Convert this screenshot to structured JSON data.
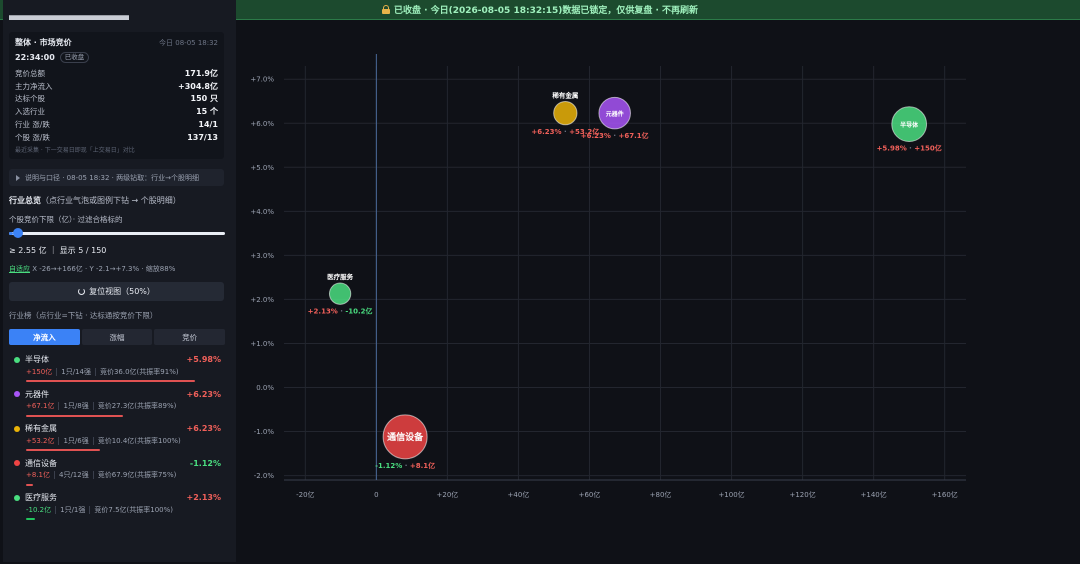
{
  "banner": {
    "text": "已收盘 · 今日(2026-08-05 18:32:15)数据已锁定，仅供复盘 · 不再刷新",
    "icon": "lock-icon",
    "color": "#9ff0bd"
  },
  "summary": {
    "title": "整体 · 市场竞价",
    "date": "今日 08-05 18:32",
    "time": "22:34:00",
    "badge": "已收盘",
    "rows": [
      {
        "label": "竞价总额",
        "value": "171.9亿"
      },
      {
        "label": "主力净流入",
        "value": "+304.8亿"
      },
      {
        "label": "达标个股",
        "value": "150 只"
      },
      {
        "label": "入选行业",
        "value": "15 个"
      },
      {
        "label": "行业 涨/跌",
        "value": "14/1"
      },
      {
        "label": "个股 涨/跌",
        "value": "137/13"
      }
    ],
    "note": "最近采集 · 下一交易日即现「上交易日」对比"
  },
  "collapse": {
    "text": "说明与口径 · 08-05 18:32 · 两级钻取：行业→个股明细"
  },
  "section": {
    "title": "行业总览",
    "hint": "（点行业气泡或图例下钻 → 个股明细）"
  },
  "filter": {
    "label": "个股竞价下限（亿）· 过滤合格标的",
    "value_fraction": 0.02,
    "threshold": "≥ 2.55 亿 ｜ 显示 5 / 150"
  },
  "adaptive": {
    "link": "自适应",
    "text": "X -26→+166亿 · Y -2.1→+7.3% · 缩放88%"
  },
  "reset": {
    "label": "复位视图（50%）"
  },
  "list_hint": "行业榜（点行业=下钻 · 达标通按竞价下限）",
  "tabs": [
    {
      "label": "净流入",
      "active": true
    },
    {
      "label": "涨幅",
      "active": false
    },
    {
      "label": "竞价",
      "active": false
    }
  ],
  "industries": [
    {
      "name": "半导体",
      "color": "#4ade80",
      "change": "+5.98%",
      "flow": "+150亿",
      "stocks": "1只/14强",
      "auction": "竞价36.0亿(共振率91%)",
      "bar": 0.91,
      "sign": "pos",
      "flow_sign": "pos",
      "bar_color": "#e05252"
    },
    {
      "name": "元器件",
      "color": "#a855f7",
      "change": "+6.23%",
      "flow": "+67.1亿",
      "stocks": "1只/8强",
      "auction": "竞价27.3亿(共振率89%)",
      "bar": 0.52,
      "sign": "pos",
      "flow_sign": "pos",
      "bar_color": "#e05252"
    },
    {
      "name": "稀有金属",
      "color": "#eab308",
      "change": "+6.23%",
      "flow": "+53.2亿",
      "stocks": "1只/6强",
      "auction": "竞价10.4亿(共振率100%)",
      "bar": 0.4,
      "sign": "pos",
      "flow_sign": "pos",
      "bar_color": "#e05252"
    },
    {
      "name": "通信设备",
      "color": "#ef4444",
      "change": "-1.12%",
      "flow": "+8.1亿",
      "stocks": "4只/12强",
      "auction": "竞价67.9亿(共振率75%)",
      "bar": 0.04,
      "sign": "neg",
      "flow_sign": "pos",
      "bar_color": "#e05252"
    },
    {
      "name": "医疗服务",
      "color": "#4ade80",
      "change": "+2.13%",
      "flow": "-10.2亿",
      "stocks": "1只/1强",
      "auction": "竞价7.5亿(共振率100%)",
      "bar": 0.05,
      "sign": "pos",
      "flow_sign": "neg",
      "bar_color": "#22c55e"
    }
  ],
  "chart_data": {
    "type": "scatter",
    "xlim": [
      -26,
      166
    ],
    "ylim": [
      -2.1,
      7.3
    ],
    "x_ticks": [
      -20,
      0,
      20,
      40,
      60,
      80,
      100,
      120,
      140,
      160
    ],
    "x_tick_labels": [
      "-20亿",
      "0",
      "+20亿",
      "+40亿",
      "+60亿",
      "+80亿",
      "+100亿",
      "+120亿",
      "+140亿",
      "+160亿"
    ],
    "y_ticks": [
      -2,
      -1,
      0,
      1,
      2,
      3,
      4,
      5,
      6,
      7
    ],
    "y_tick_labels": [
      "-2.0%",
      "-1.0%",
      "0.0%",
      "+1.0%",
      "+2.0%",
      "+3.0%",
      "+4.0%",
      "+5.0%",
      "+6.0%",
      "+7.0%"
    ],
    "grid": true,
    "points": [
      {
        "name": "半导体",
        "x": 150,
        "y": 5.98,
        "size": 36.0,
        "color": "#4ade80",
        "chg": "+5.98%",
        "flow": "+150亿",
        "chg_sign": "pos",
        "flow_sign": "pos",
        "label_pos": "inside"
      },
      {
        "name": "元器件",
        "x": 67.1,
        "y": 6.23,
        "size": 27.3,
        "color": "#a855f7",
        "chg": "+6.23%",
        "flow": "+67.1亿",
        "chg_sign": "pos",
        "flow_sign": "pos",
        "label_pos": "inside"
      },
      {
        "name": "稀有金属",
        "x": 53.2,
        "y": 6.23,
        "size": 10.4,
        "color": "#eab308",
        "chg": "+6.23%",
        "flow": "+53.2亿",
        "chg_sign": "pos",
        "flow_sign": "pos",
        "label_pos": "above"
      },
      {
        "name": "通信设备",
        "x": 8.1,
        "y": -1.12,
        "size": 67.9,
        "color": "#ef4444",
        "chg": "-1.12%",
        "flow": "+8.1亿",
        "chg_sign": "neg",
        "flow_sign": "pos",
        "label_pos": "inside"
      },
      {
        "name": "医疗服务",
        "x": -10.2,
        "y": 2.13,
        "size": 7.5,
        "color": "#4ade80",
        "chg": "+2.13%",
        "flow": "-10.2亿",
        "chg_sign": "pos",
        "flow_sign": "neg",
        "label_pos": "above"
      }
    ]
  }
}
